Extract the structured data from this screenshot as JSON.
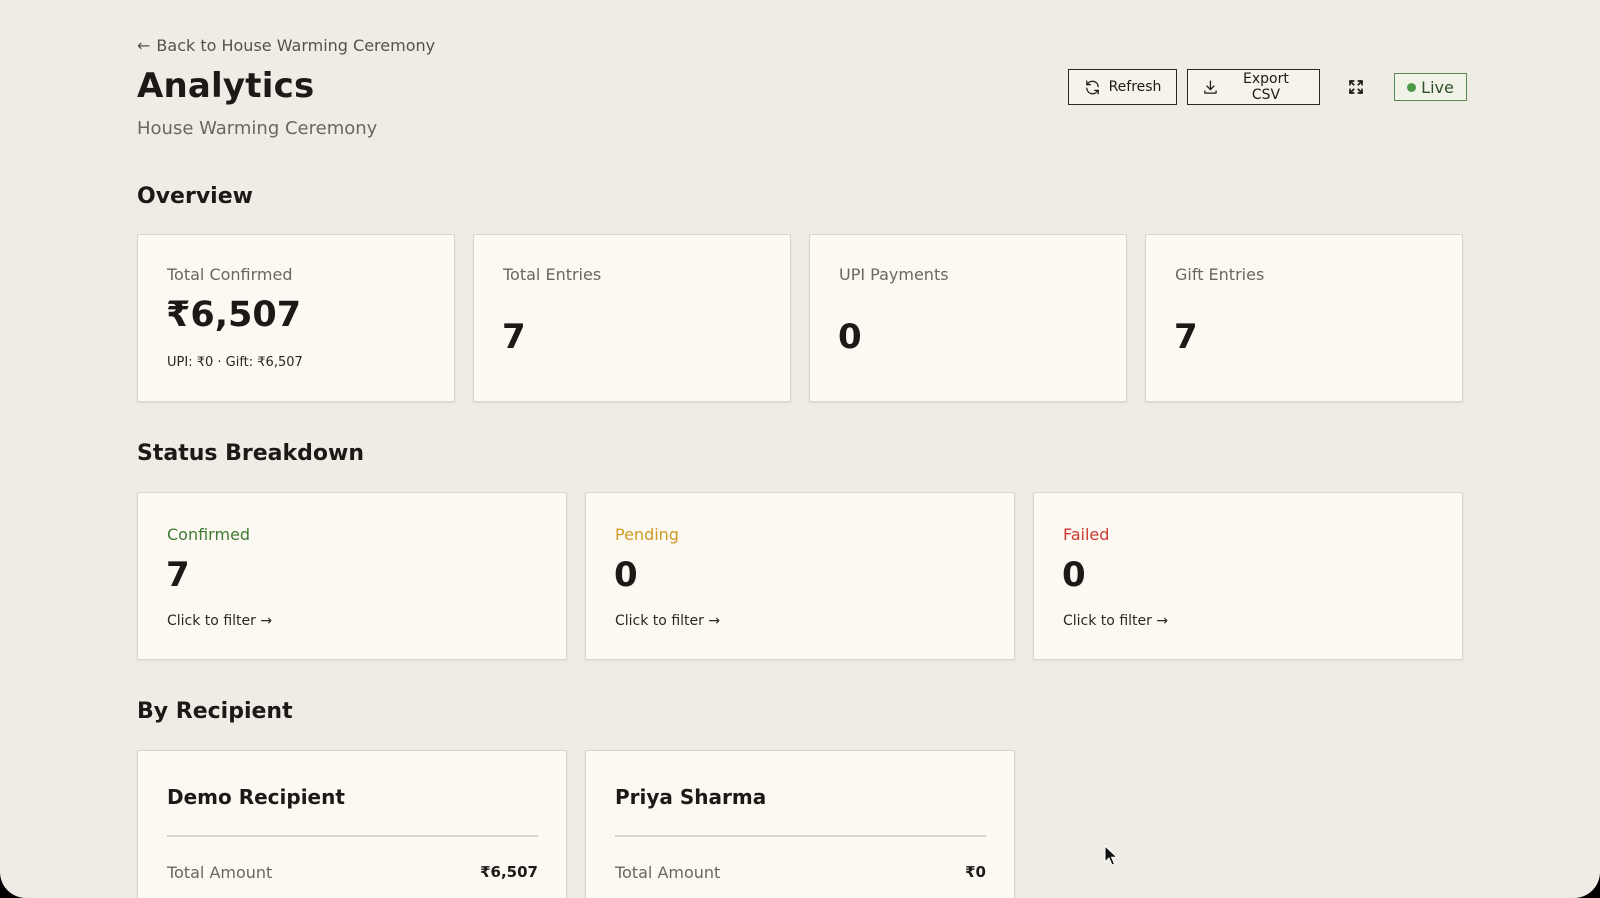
{
  "header": {
    "back_label": "Back to House Warming Ceremony",
    "title": "Analytics",
    "subtitle": "House Warming Ceremony",
    "refresh_label": "Refresh",
    "export_label": "Export CSV",
    "live_label": "Live"
  },
  "overview": {
    "title": "Overview",
    "cards": [
      {
        "label": "Total Confirmed",
        "value": "₹6,507",
        "sub": "UPI: ₹0 · Gift: ₹6,507"
      },
      {
        "label": "Total Entries",
        "value": "7"
      },
      {
        "label": "UPI Payments",
        "value": "0"
      },
      {
        "label": "Gift Entries",
        "value": "7"
      }
    ]
  },
  "status": {
    "title": "Status Breakdown",
    "cards": [
      {
        "label": "Confirmed",
        "value": "7",
        "link": "Click to filter →",
        "color": "#3f7a35"
      },
      {
        "label": "Pending",
        "value": "0",
        "link": "Click to filter →",
        "color": "#cf9a26"
      },
      {
        "label": "Failed",
        "value": "0",
        "link": "Click to filter →",
        "color": "#cc3b32"
      }
    ]
  },
  "recipients": {
    "title": "By Recipient",
    "cards": [
      {
        "name": "Demo Recipient",
        "row_label": "Total Amount",
        "row_value": "₹6,507"
      },
      {
        "name": "Priya Sharma",
        "row_label": "Total Amount",
        "row_value": "₹0"
      }
    ]
  },
  "icons": {
    "back": "arrow-left-icon",
    "refresh": "refresh-icon",
    "export": "download-icon",
    "fullscreen": "expand-icon",
    "live": "status-dot-icon"
  }
}
